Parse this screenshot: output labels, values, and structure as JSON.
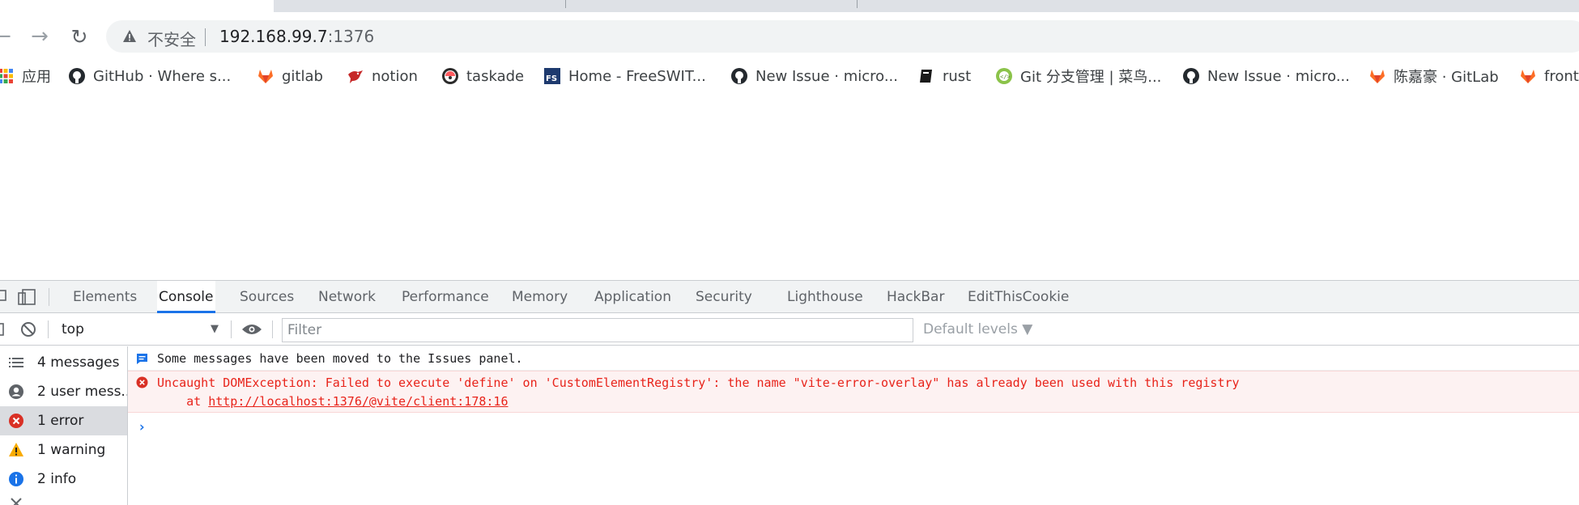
{
  "toolbar": {
    "security_label": "不安全",
    "url_host": "192.168.99.7",
    "url_port": ":1376"
  },
  "bookmarks": [
    {
      "label": "应用",
      "icon": "apps-grid-icon"
    },
    {
      "label": "GitHub · Where s...",
      "icon": "github-icon"
    },
    {
      "label": "gitlab",
      "icon": "gitlab-icon"
    },
    {
      "label": "notion",
      "icon": "notion-bird-icon"
    },
    {
      "label": "taskade",
      "icon": "taskade-icon"
    },
    {
      "label": "Home - FreeSWIT...",
      "icon": "freeswitch-icon"
    },
    {
      "label": "New Issue · micro...",
      "icon": "github-icon"
    },
    {
      "label": "rust",
      "icon": "rust-book-icon"
    },
    {
      "label": "Git 分支管理 | 菜鸟...",
      "icon": "runoob-icon"
    },
    {
      "label": "New Issue · micro...",
      "icon": "github-icon"
    },
    {
      "label": "陈嘉豪 · GitLab",
      "icon": "gitlab-icon"
    },
    {
      "label": "front",
      "icon": "gitlab-icon"
    }
  ],
  "devtools": {
    "tabs": [
      "Elements",
      "Console",
      "Sources",
      "Network",
      "Performance",
      "Memory",
      "Application",
      "Security",
      "Lighthouse",
      "HackBar",
      "EditThisCookie"
    ],
    "active_tab": "Console",
    "context": "top",
    "filter_placeholder": "Filter",
    "levels_label": "Default levels ▼",
    "sidebar": [
      {
        "label": "4 messages",
        "icon": "list-icon"
      },
      {
        "label": "2 user mess...",
        "icon": "user-icon"
      },
      {
        "label": "1 error",
        "icon": "error-icon"
      },
      {
        "label": "1 warning",
        "icon": "warning-icon"
      },
      {
        "label": "2 info",
        "icon": "info-icon"
      }
    ],
    "messages": {
      "info": "Some messages have been moved to the Issues panel.",
      "error_line1": "Uncaught DOMException: Failed to execute 'define' on 'CustomElementRegistry': the name \"vite-error-overlay\" has already been used with this registry",
      "error_at": "    at ",
      "error_link": "http://localhost:1376/@vite/client:178:16"
    },
    "prompt": "›"
  },
  "colors": {
    "accent": "#1a73e8",
    "error": "#e8231a",
    "error_bg": "#fdf2f2"
  }
}
